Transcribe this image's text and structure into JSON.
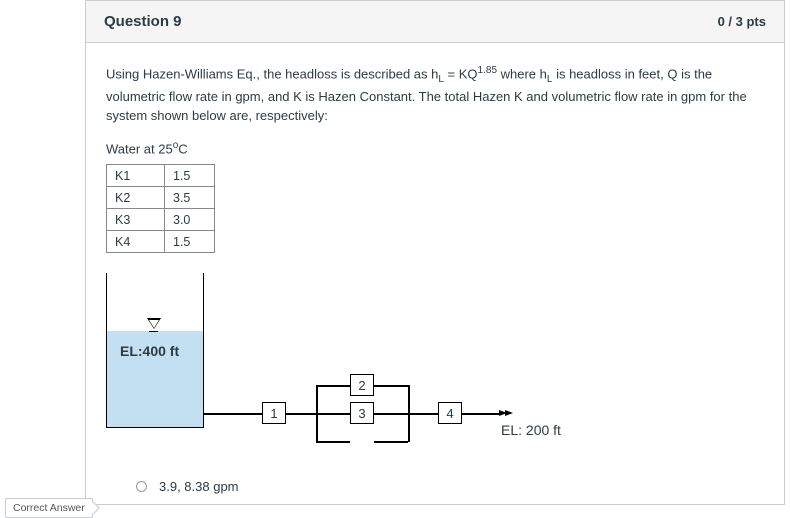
{
  "header": {
    "title": "Question 9",
    "points": "0 / 3 pts"
  },
  "stem": {
    "pre": "Using Hazen-Williams Eq., the headloss is described as h",
    "sub1": "L",
    "mid1": " = KQ",
    "sup1": "1.85",
    "mid2": " where h",
    "sub2": "L",
    "post": " is headloss in feet, Q is the volumetric flow rate in gpm, and K is Hazen Constant. The total Hazen K and volumetric flow rate in gpm for the system shown below are, respectively:"
  },
  "water_label_pre": "Water at 25",
  "water_label_sup": "o",
  "water_label_post": "C",
  "ktable": [
    {
      "k": "K1",
      "v": "1.5"
    },
    {
      "k": "K2",
      "v": "3.5"
    },
    {
      "k": "K3",
      "v": "3.0"
    },
    {
      "k": "K4",
      "v": "1.5"
    }
  ],
  "diagram": {
    "el_tank": "EL:400 ft",
    "box1": "1",
    "box2": "2",
    "box3": "3",
    "box4": "4",
    "el_out": "EL: 200 ft"
  },
  "answer": {
    "text": "3.9, 8.38 gpm",
    "correct_badge": "Correct Answer"
  }
}
